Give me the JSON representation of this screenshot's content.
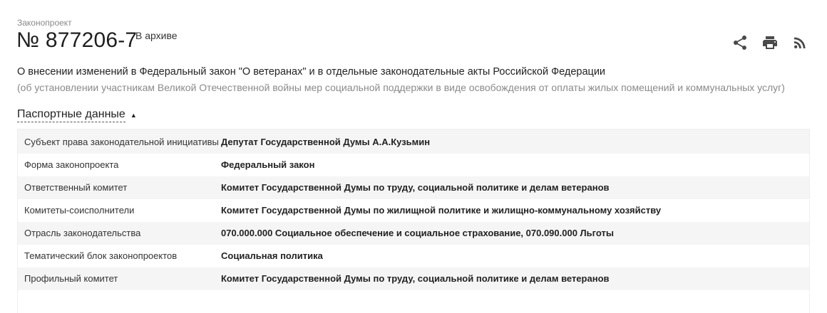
{
  "header": {
    "kicker": "Законопроект",
    "number": "№ 877206-7",
    "status_badge": "В архиве",
    "actions": [
      {
        "name": "share",
        "icon": "share-icon"
      },
      {
        "name": "print",
        "icon": "print-icon"
      },
      {
        "name": "rss",
        "icon": "rss-icon"
      }
    ]
  },
  "bill": {
    "title": "О внесении изменений в Федеральный закон \"О ветеранах\" и в отдельные законодательные акты Российской Федерации",
    "subtitle": "(об установлении участникам Великой Отечественной войны мер социальной поддержки в виде освобождения от оплаты жилых помещений и коммунальных услуг)"
  },
  "passport": {
    "section_label": "Паспортные данные",
    "expanded": true,
    "rows": [
      {
        "key": "Субъект права законодательной инициативы",
        "value": "Депутат Государственной Думы А.А.Кузьмин"
      },
      {
        "key": "Форма законопроекта",
        "value": "Федеральный закон"
      },
      {
        "key": "Ответственный комитет",
        "value": "Комитет Государственной Думы по труду, социальной политике и делам ветеранов"
      },
      {
        "key": "Комитеты-соисполнители",
        "value": "Комитет Государственной Думы по жилищной политике и жилищно-коммунальному хозяйству"
      },
      {
        "key": "Отрасль законодательства",
        "value": "070.000.000 Социальное обеспечение и социальное страхование, 070.090.000 Льготы"
      },
      {
        "key": "Тематический блок законопроектов",
        "value": "Социальная политика"
      },
      {
        "key": "Профильный комитет",
        "value": "Комитет Государственной Думы по труду, социальной политике и делам ветеранов"
      }
    ]
  },
  "colors": {
    "text": "#222222",
    "muted": "#8a8a8a",
    "row_alt": "#f5f5f5",
    "icon": "#4a4a4a"
  }
}
